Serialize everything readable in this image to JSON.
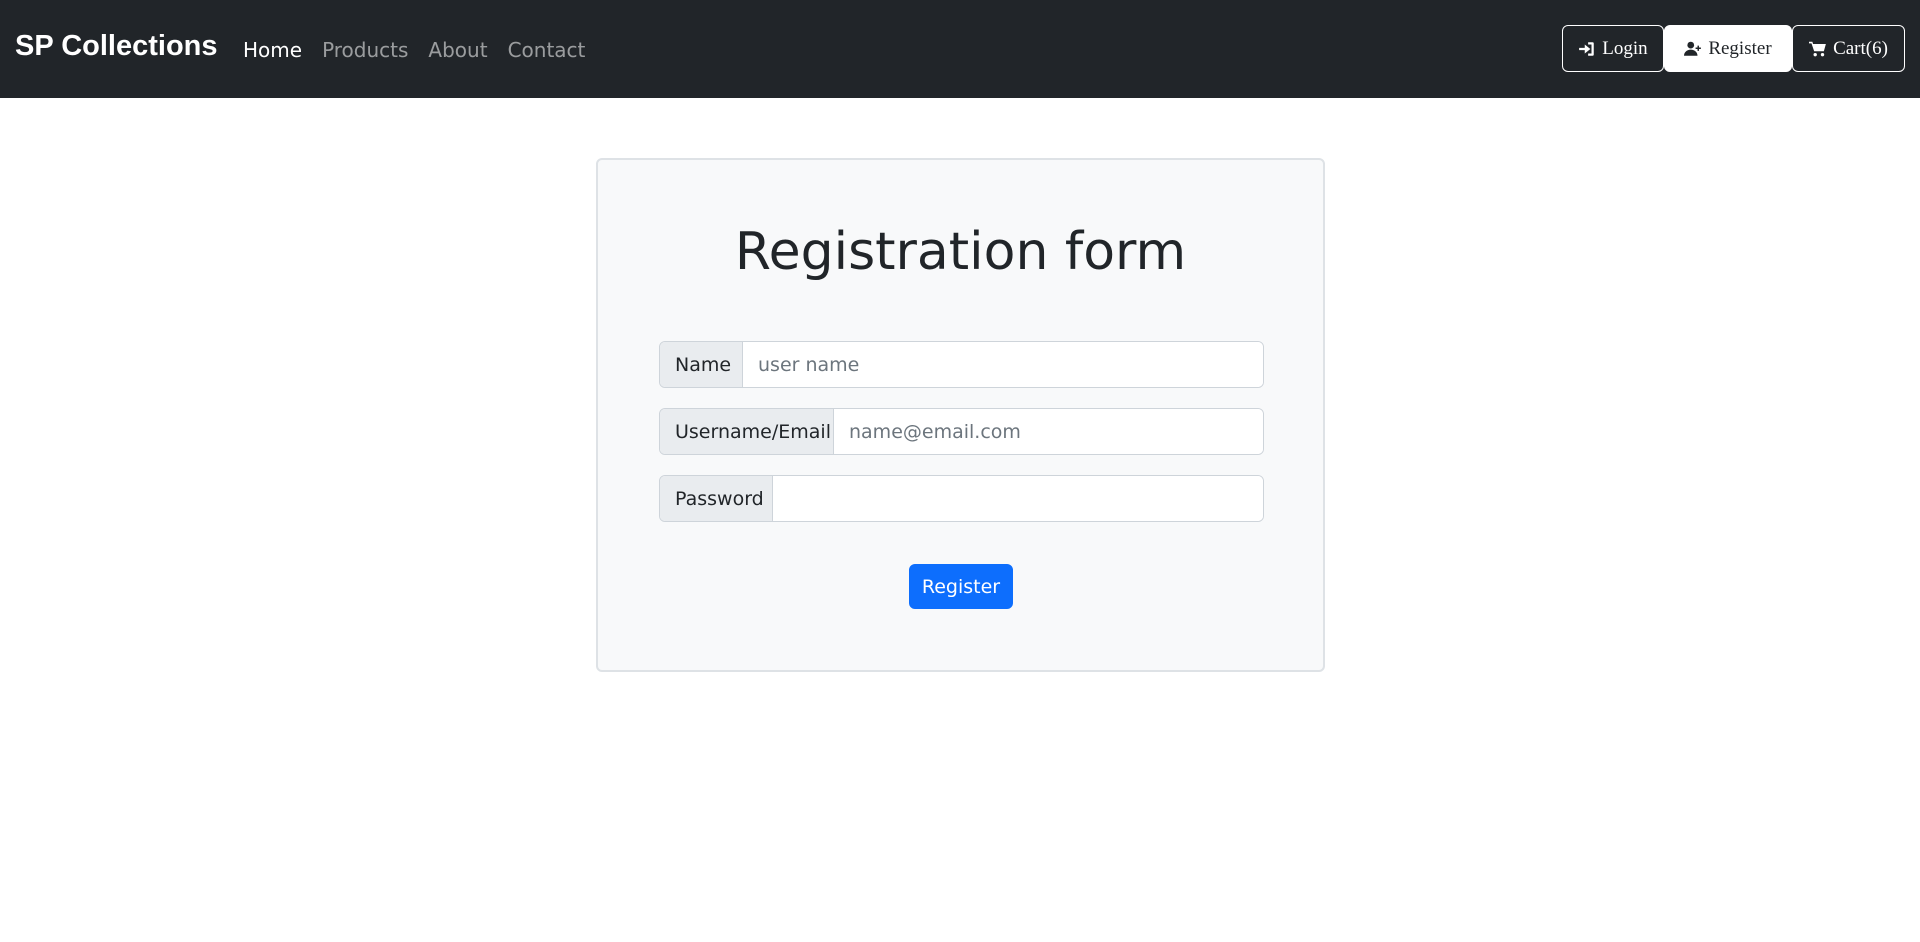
{
  "navbar": {
    "brand": "SP Collections",
    "links": [
      {
        "label": "Home",
        "active": true
      },
      {
        "label": "Products",
        "active": false
      },
      {
        "label": "About",
        "active": false
      },
      {
        "label": "Contact",
        "active": false
      }
    ],
    "buttons": {
      "login": {
        "label": "Login",
        "icon": "sign-in-icon"
      },
      "register": {
        "label": "Register",
        "icon": "user-plus-icon"
      },
      "cart": {
        "label": "Cart(6)",
        "icon": "shopping-cart-icon"
      }
    }
  },
  "form": {
    "title": "Registration form",
    "fields": {
      "name": {
        "label": "Name",
        "placeholder": "user name",
        "value": ""
      },
      "email": {
        "label": "Username/Email",
        "placeholder": "name@email.com",
        "value": ""
      },
      "password": {
        "label": "Password",
        "placeholder": "",
        "value": ""
      }
    },
    "submit_label": "Register"
  },
  "colors": {
    "navbar_bg": "#212529",
    "card_bg": "#f8f9fa",
    "primary": "#0d6efd"
  }
}
